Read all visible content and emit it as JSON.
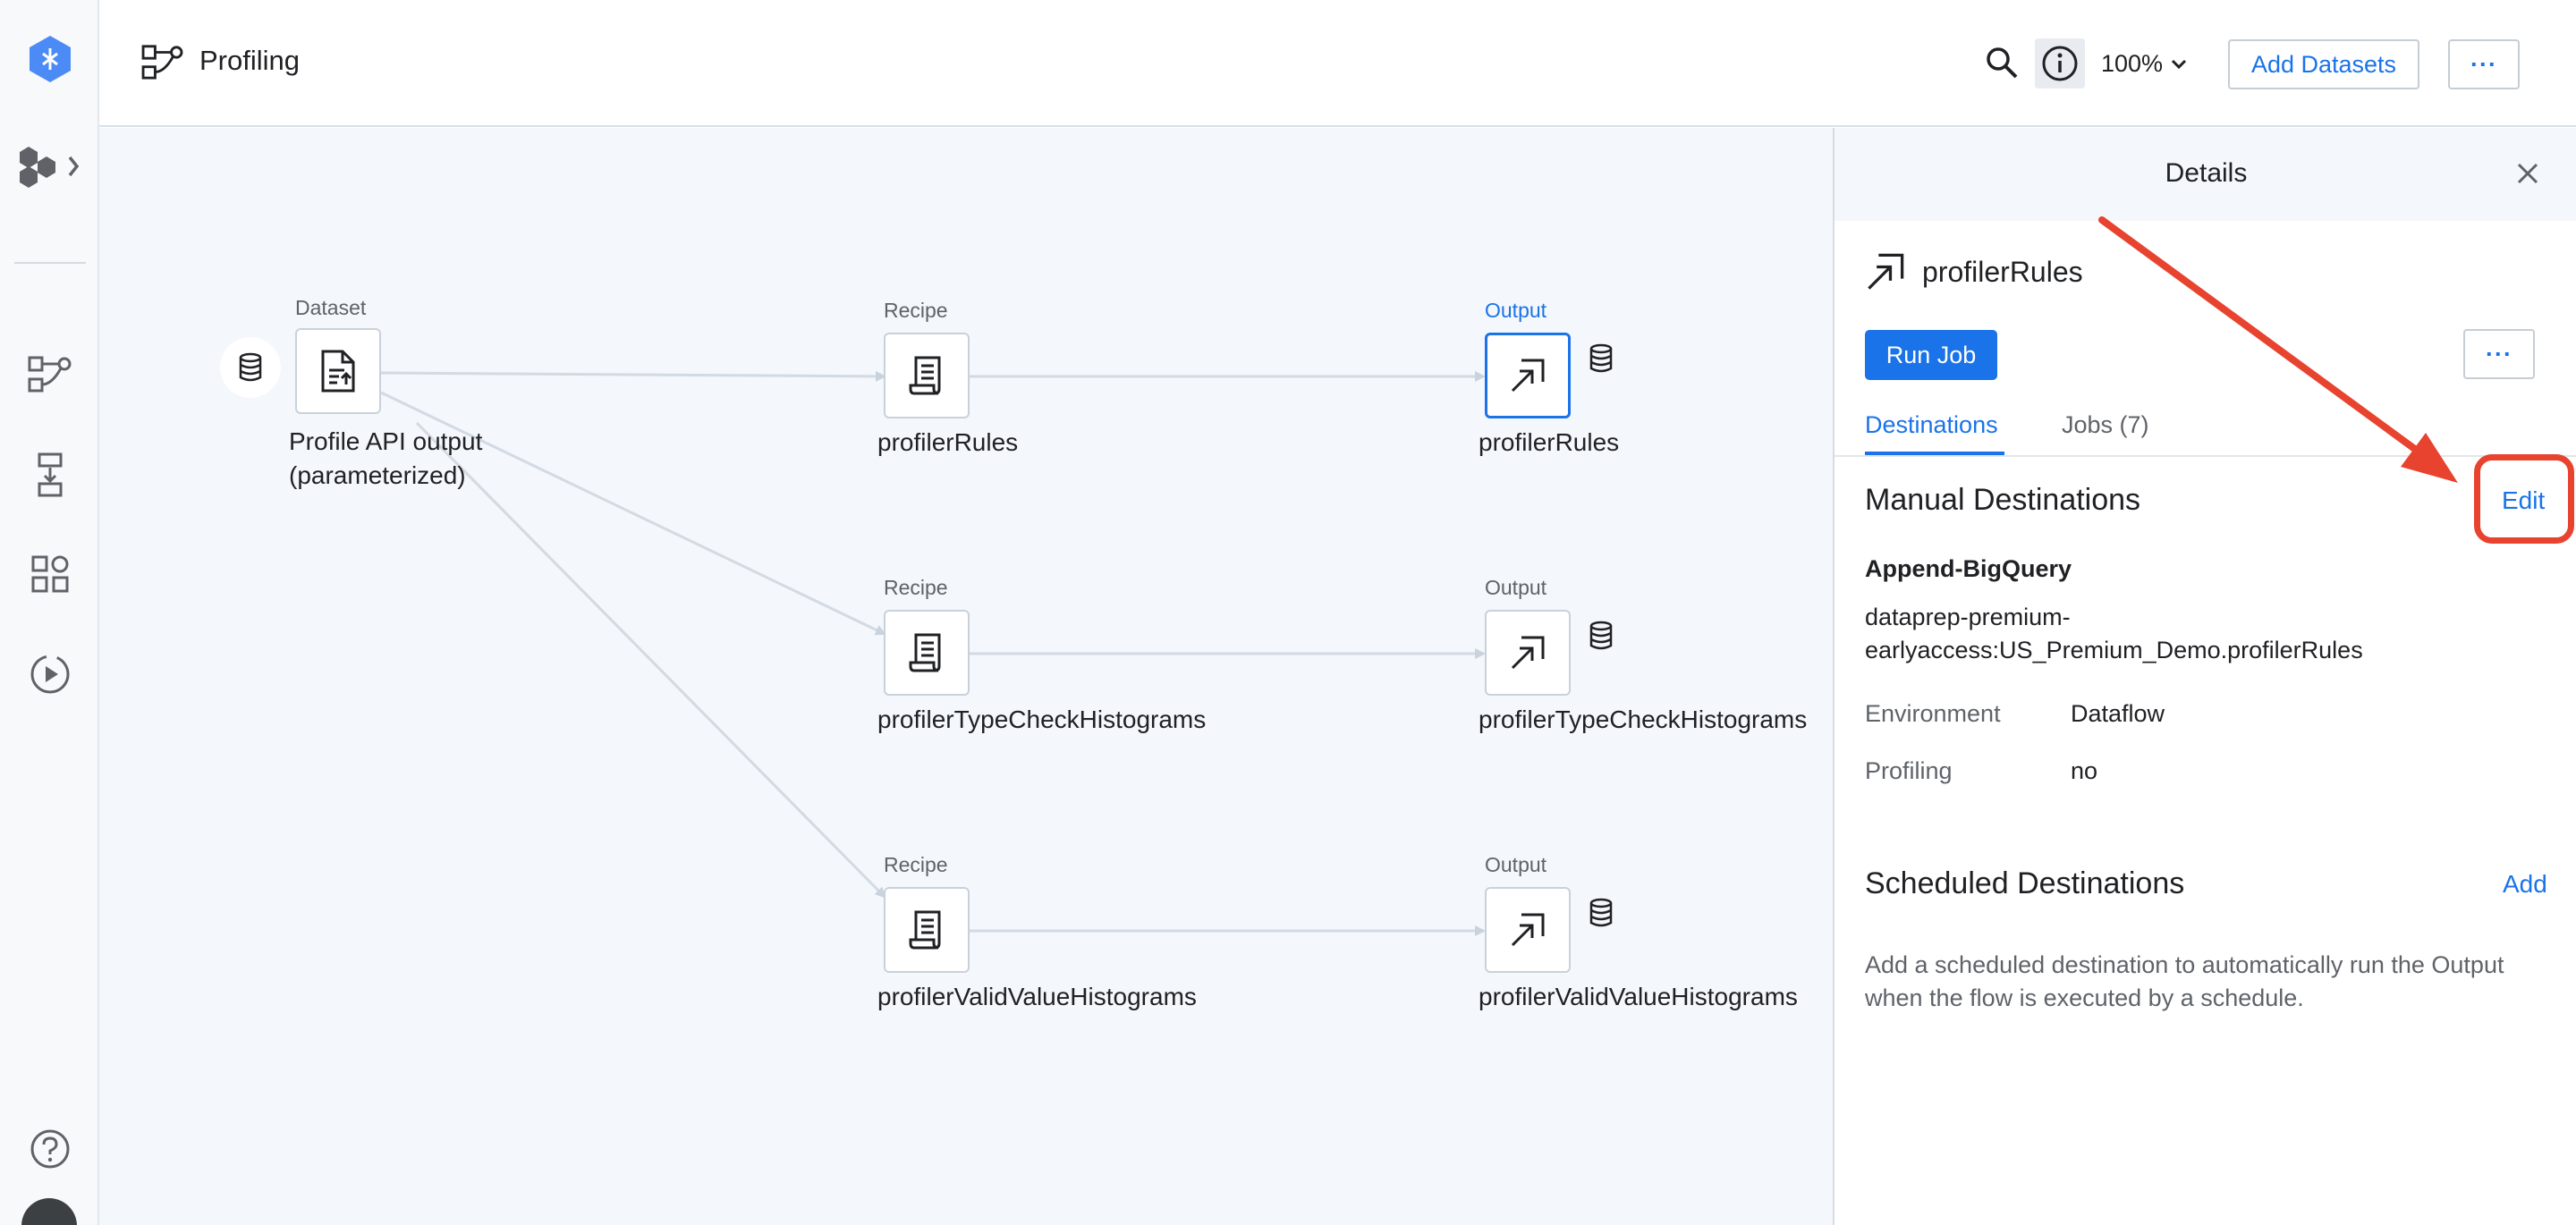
{
  "header": {
    "title": "Profiling",
    "zoom": "100%",
    "add_datasets_label": "Add Datasets",
    "more_label": "···"
  },
  "flow": {
    "dataset": {
      "type_label": "Dataset",
      "name_line1": "Profile API output",
      "name_line2": "(parameterized)"
    },
    "recipes": [
      {
        "type_label": "Recipe",
        "name": "profilerRules"
      },
      {
        "type_label": "Recipe",
        "name": "profilerTypeCheckHistograms"
      },
      {
        "type_label": "Recipe",
        "name": "profilerValidValueHistograms"
      }
    ],
    "outputs": [
      {
        "type_label": "Output",
        "name": "profilerRules",
        "selected": true
      },
      {
        "type_label": "Output",
        "name": "profilerTypeCheckHistograms",
        "selected": false
      },
      {
        "type_label": "Output",
        "name": "profilerValidValueHistograms",
        "selected": false
      }
    ]
  },
  "details": {
    "title": "Details",
    "output_name": "profilerRules",
    "run_job_label": "Run Job",
    "more_label": "···",
    "tabs": [
      {
        "label": "Destinations",
        "active": true
      },
      {
        "label": "Jobs (7)",
        "active": false
      }
    ],
    "manual": {
      "title": "Manual Destinations",
      "edit_label": "Edit",
      "destination_name": "Append-BigQuery",
      "destination_path_line1": "dataprep-premium-",
      "destination_path_line2": "earlyaccess:US_Premium_Demo.profilerRules",
      "environment_label": "Environment",
      "environment_value": "Dataflow",
      "profiling_label": "Profiling",
      "profiling_value": "no"
    },
    "scheduled": {
      "title": "Scheduled Destinations",
      "add_label": "Add",
      "description": "Add a scheduled destination to automatically run the Output when the flow is executed by a schedule."
    }
  },
  "colors": {
    "accent": "#1a73e8",
    "annotation": "#e8432f",
    "canvas_bg": "#f4f7fb"
  }
}
